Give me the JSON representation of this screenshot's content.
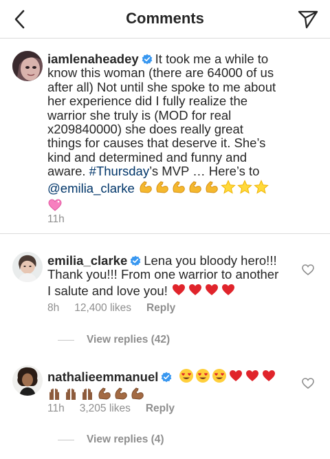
{
  "header": {
    "title": "Comments"
  },
  "caption": {
    "username": "iamlenaheadey",
    "text_lines": [
      "It took me a while to",
      "know this woman (there are 64000 of us",
      "after all) Not until she spoke to me about",
      "her experience did I fully realize the",
      "warrior she truly is (MOD for real",
      "x209840000) she does really great",
      "things for causes that deserve it. She’s",
      "kind and determined and funny  and",
      "aware."
    ],
    "hashtag": "#Thursday",
    "after_hashtag": "’s MVP … Here’s to",
    "mention": "@emilia_clarke",
    "time": "11h"
  },
  "comments": [
    {
      "username": "emilia_clarke",
      "text_lines": [
        "Lena you bloody hero!!!",
        "Thank you!!! From one warrior to another",
        "I salute and love you!"
      ],
      "time": "8h",
      "likes": "12,400 likes",
      "reply": "Reply",
      "view_replies": "View replies (42)"
    },
    {
      "username": "nathalieemmanuel",
      "time": "11h",
      "likes": "3,205 likes",
      "reply": "Reply",
      "view_replies": "View replies (4)"
    }
  ],
  "colors": {
    "text": "#262626",
    "muted": "#8e8e8e",
    "link": "#003569",
    "verified": "#3897f0",
    "divider": "#dbdbdb"
  },
  "icons": [
    "back-arrow-icon",
    "direct-share-icon",
    "verified-badge-icon",
    "heart-outline-icon"
  ]
}
